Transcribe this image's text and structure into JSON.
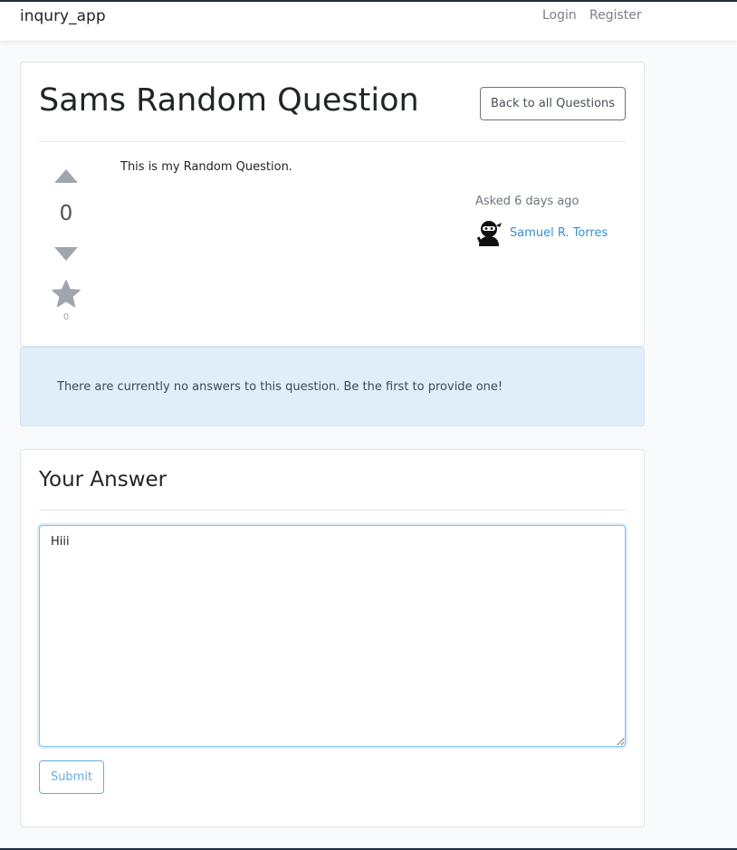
{
  "navbar": {
    "brand": "inqury_app",
    "login_label": "Login",
    "register_label": "Register"
  },
  "question": {
    "title": "Sams Random Question",
    "back_label": "Back to all Questions",
    "body": "This is my Random Question.",
    "votes": "0",
    "favorites": "0",
    "asked": "Asked 6 days ago",
    "author": "Samuel R. Torres"
  },
  "alert": {
    "message": "There are currently no answers to this question. Be the first to provide one!"
  },
  "answer_form": {
    "title": "Your Answer",
    "value": "Hiii",
    "submit_label": "Submit"
  },
  "colors": {
    "accent": "#3490dc",
    "muted_icon": "#a0a6ad",
    "alert_bg": "#dfeef8"
  },
  "icons": [
    "arrow-up-icon",
    "arrow-down-icon",
    "star-icon",
    "ninja-avatar-icon"
  ]
}
